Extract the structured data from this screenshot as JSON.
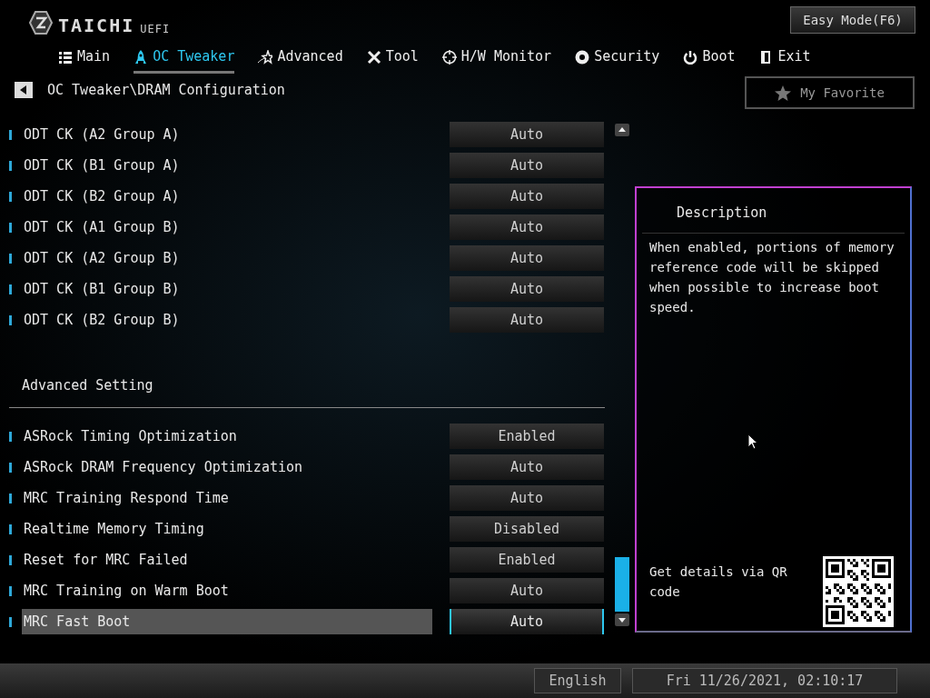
{
  "header": {
    "logo_text": "TAICHI",
    "logo_suffix": "UEFI",
    "easy_mode_button": "Easy Mode(F6)"
  },
  "tabs": [
    {
      "label": "Main",
      "selected": false
    },
    {
      "label": "OC Tweaker",
      "selected": true
    },
    {
      "label": "Advanced",
      "selected": false
    },
    {
      "label": "Tool",
      "selected": false
    },
    {
      "label": "H/W Monitor",
      "selected": false
    },
    {
      "label": "Security",
      "selected": false
    },
    {
      "label": "Boot",
      "selected": false
    },
    {
      "label": "Exit",
      "selected": false
    }
  ],
  "breadcrumb": "OC Tweaker\\DRAM Configuration",
  "favorite_button": "My Favorite",
  "settings": [
    {
      "kind": "setting",
      "label": "ODT CK (A2 Group A)",
      "value": "Auto",
      "selected": false
    },
    {
      "kind": "setting",
      "label": "ODT CK (B1 Group A)",
      "value": "Auto",
      "selected": false
    },
    {
      "kind": "setting",
      "label": "ODT CK (B2 Group A)",
      "value": "Auto",
      "selected": false
    },
    {
      "kind": "setting",
      "label": "ODT CK (A1 Group B)",
      "value": "Auto",
      "selected": false
    },
    {
      "kind": "setting",
      "label": "ODT CK (A2 Group B)",
      "value": "Auto",
      "selected": false
    },
    {
      "kind": "setting",
      "label": "ODT CK (B1 Group B)",
      "value": "Auto",
      "selected": false
    },
    {
      "kind": "setting",
      "label": "ODT CK (B2 Group B)",
      "value": "Auto",
      "selected": false
    },
    {
      "kind": "heading",
      "label": "Advanced Setting"
    },
    {
      "kind": "setting",
      "label": "ASRock Timing Optimization",
      "value": "Enabled",
      "selected": false
    },
    {
      "kind": "setting",
      "label": "ASRock DRAM Frequency Optimization",
      "value": "Auto",
      "selected": false
    },
    {
      "kind": "setting",
      "label": "MRC Training Respond Time",
      "value": "Auto",
      "selected": false
    },
    {
      "kind": "setting",
      "label": "Realtime Memory Timing",
      "value": "Disabled",
      "selected": false
    },
    {
      "kind": "setting",
      "label": "Reset for MRC Failed",
      "value": "Enabled",
      "selected": false
    },
    {
      "kind": "setting",
      "label": "MRC Training on Warm Boot",
      "value": "Auto",
      "selected": false
    },
    {
      "kind": "setting",
      "label": "MRC Fast Boot",
      "value": "Auto",
      "selected": true
    }
  ],
  "description": {
    "title": "Description",
    "text": "When enabled, portions of memory reference code will be skipped when possible to increase boot speed.",
    "qr_text": "Get details via QR code"
  },
  "status_bar": {
    "language": "English",
    "datetime": "Fri 11/26/2021, 02:10:17"
  }
}
